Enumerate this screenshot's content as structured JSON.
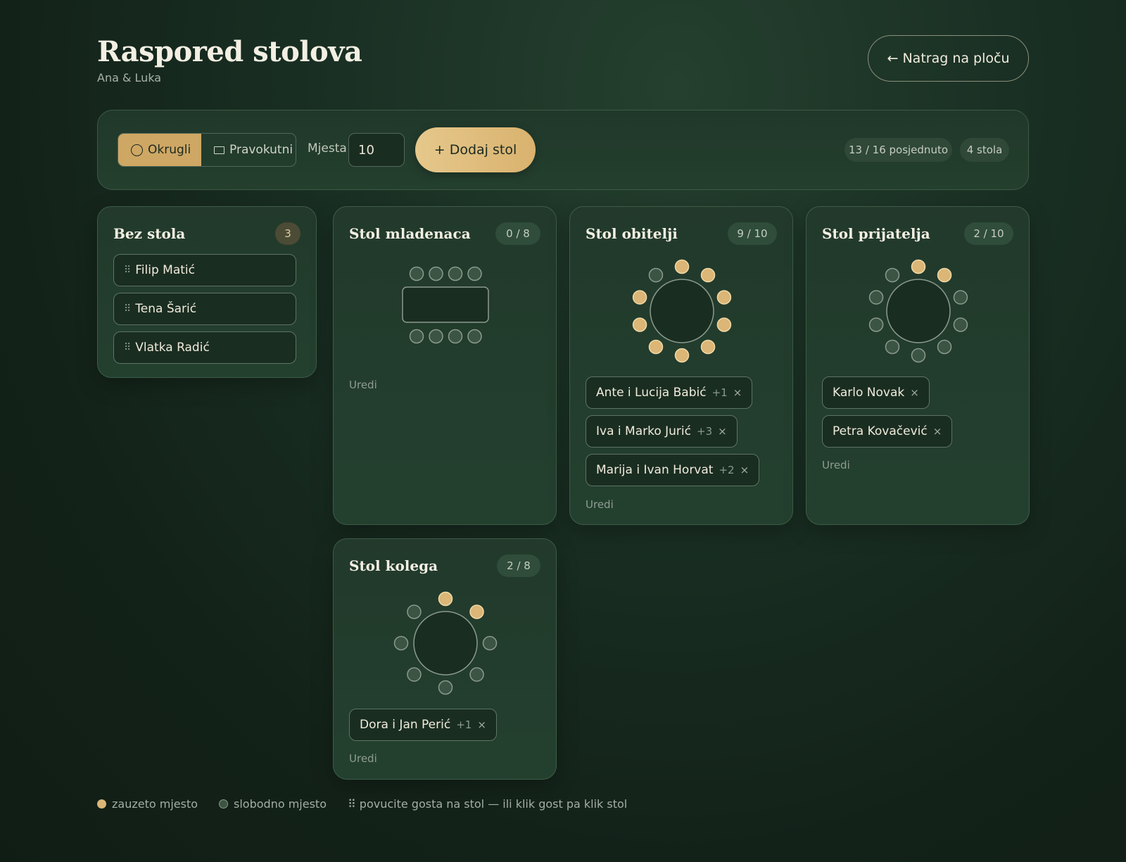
{
  "header": {
    "title": "Raspored stolova",
    "subtitle": "Ana & Luka",
    "back_label": "← Natrag na ploču"
  },
  "toolbar": {
    "shape_round": "Okrugli",
    "shape_rect": "Pravokutni",
    "seats_label": "Mjesta",
    "seats_value": "10",
    "add_label": "+ Dodaj stol",
    "seated_summary": "13 / 16 posjednuto",
    "table_count": "4 stola"
  },
  "unseated": {
    "title": "Bez stola",
    "count": "3",
    "guests": [
      "Filip Matić",
      "Tena Šarić",
      "Vlatka Radić"
    ]
  },
  "tables": [
    {
      "title": "Stol mladenaca",
      "count": "0 / 8",
      "shape": "rect",
      "seats": 8,
      "occupied": 0,
      "guests": [],
      "edit": "Uredi"
    },
    {
      "title": "Stol obitelji",
      "count": "9 / 10",
      "shape": "round",
      "seats": 10,
      "occupied": 9,
      "guests": [
        {
          "name": "Ante i Lucija Babić",
          "plus": "+1"
        },
        {
          "name": "Iva i Marko Jurić",
          "plus": "+3"
        },
        {
          "name": "Marija i Ivan Horvat",
          "plus": "+2"
        }
      ],
      "edit": "Uredi"
    },
    {
      "title": "Stol prijatelja",
      "count": "2 / 10",
      "shape": "round",
      "seats": 10,
      "occupied": 2,
      "guests": [
        {
          "name": "Karlo Novak",
          "plus": ""
        },
        {
          "name": "Petra Kovačević",
          "plus": ""
        }
      ],
      "edit": "Uredi"
    },
    {
      "title": "Stol kolega",
      "count": "2 / 8",
      "shape": "round",
      "seats": 8,
      "occupied": 2,
      "guests": [
        {
          "name": "Dora i Jan Perić",
          "plus": "+1"
        }
      ],
      "edit": "Uredi"
    }
  ],
  "legend": {
    "occupied": "zauzeto mjesto",
    "free": "slobodno mjesto",
    "hint": "⠿ povucite gosta na stol — ili klik gost pa klik stol"
  },
  "colors": {
    "seat_occupied": "#dbb676",
    "seat_free": "#3b5443",
    "accent": "#cfa764"
  },
  "icons": {
    "remove": "×",
    "grip": "⠿"
  }
}
